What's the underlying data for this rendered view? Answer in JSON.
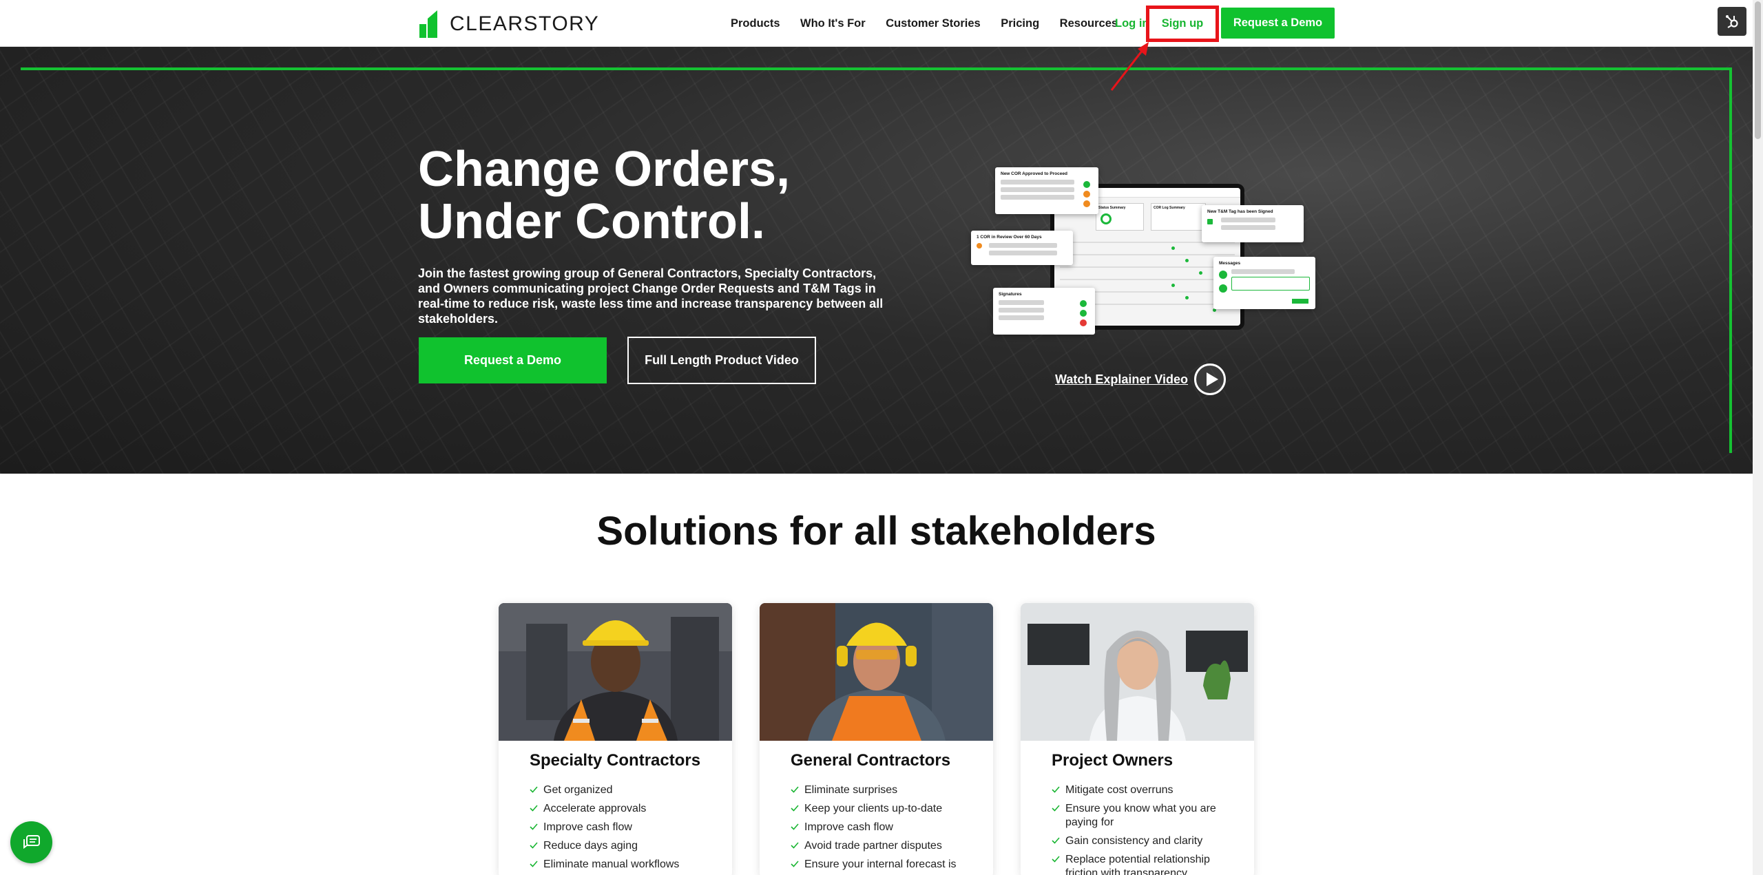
{
  "brand": {
    "name": "CLEARSTORY",
    "accent": "#10c22e"
  },
  "nav": {
    "items": [
      "Products",
      "Who It's For",
      "Customer Stories",
      "Pricing",
      "Resources"
    ],
    "login": "Log in",
    "signup": "Sign up",
    "demo": "Request a Demo"
  },
  "hero": {
    "title_line1": "Change Orders,",
    "title_line2": "Under Control.",
    "description": "Join the fastest growing group of General Contractors, Specialty Contractors, and Owners communicating project Change Order Requests and T&M Tags in real-time to reduce risk, waste less time and increase transparency between all stakeholders.",
    "cta_primary": "Request a Demo",
    "cta_secondary": "Full Length Product Video",
    "watch_video": "Watch Explainer Video",
    "mockup": {
      "card1": "New COR Approved to Proceed",
      "card2": "1 COR in Review Over 60 Days",
      "card3": "Signatures",
      "card4": "New T&M Tag has been Signed",
      "card5": "Messages",
      "status_summary": "Status Summary",
      "cor_log": "COR Log Summary"
    }
  },
  "solutions": {
    "title": "Solutions for all stakeholders",
    "cards": [
      {
        "title": "Specialty Contractors",
        "items": [
          "Get organized",
          "Accelerate approvals",
          "Improve cash flow",
          "Reduce days aging",
          "Eliminate manual workflows"
        ]
      },
      {
        "title": "General Contractors",
        "items": [
          "Eliminate surprises",
          "Keep your clients up-to-date",
          "Improve cash flow",
          "Avoid trade partner disputes",
          "Ensure your internal forecast is"
        ]
      },
      {
        "title": "Project Owners",
        "items": [
          "Mitigate cost overruns",
          "Ensure you know what you are paying for",
          "Gain consistency and clarity",
          "Replace potential relationship friction with transparency"
        ]
      }
    ]
  }
}
